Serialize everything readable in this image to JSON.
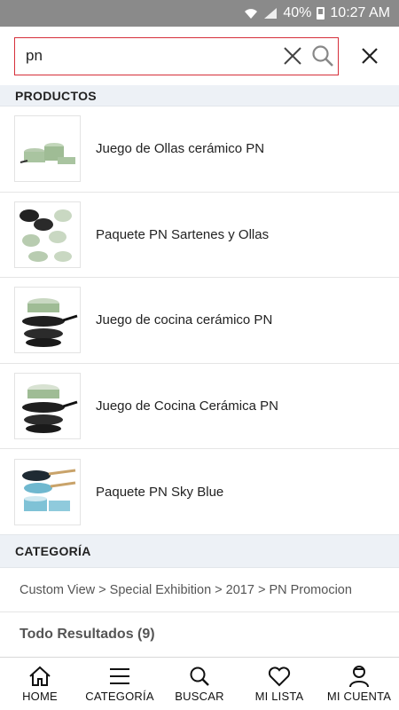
{
  "status_bar": {
    "battery": "40%",
    "time": "10:27 AM"
  },
  "search": {
    "value": "pn",
    "placeholder": ""
  },
  "sections": {
    "products": "PRODUCTOS",
    "category": "CATEGORÍA"
  },
  "products": [
    {
      "name": "Juego de Ollas cerámico PN",
      "thumb": "green-pot-set"
    },
    {
      "name": "Paquete PN Sartenes y Ollas",
      "thumb": "pan-and-pot-package"
    },
    {
      "name": "Juego de cocina cerámico PN",
      "thumb": "stacked-cookware-green"
    },
    {
      "name": "Juego de Cocina Cerámica PN",
      "thumb": "stacked-cookware-green"
    },
    {
      "name": "Paquete PN Sky Blue",
      "thumb": "sky-blue-cookware"
    }
  ],
  "category_path": "Custom View > Special Exhibition > 2017 > PN Promocion",
  "all_results": "Todo Resultados (9)",
  "nav": [
    {
      "label": "HOME",
      "icon": "home-icon"
    },
    {
      "label": "CATEGORÍA",
      "icon": "menu-icon"
    },
    {
      "label": "BUSCAR",
      "icon": "search-icon"
    },
    {
      "label": "MI LISTA",
      "icon": "heart-icon"
    },
    {
      "label": "MI CUENTA",
      "icon": "user-icon"
    }
  ],
  "colors": {
    "accent": "#d62f3a",
    "section_bg": "#edf1f6",
    "status_bar": "#8a8a8a"
  }
}
